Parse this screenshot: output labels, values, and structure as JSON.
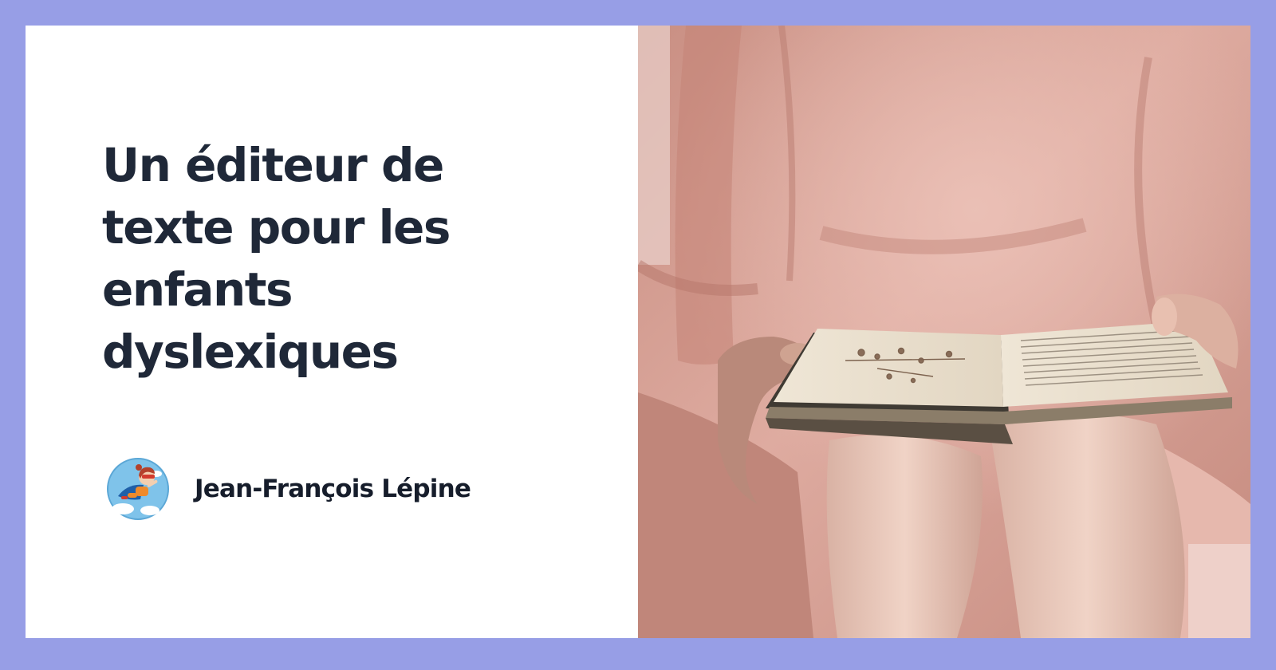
{
  "card": {
    "title": "Un éditeur de texte pour les enfants dyslexiques",
    "author": {
      "name": "Jean-François Lépine",
      "avatar_icon": "superhero-girl-avatar-icon"
    },
    "photo": {
      "subject": "child-reading-book-photo"
    }
  },
  "colors": {
    "frame": "#979ee6",
    "panel": "#ffffff",
    "title_text": "#1f2838",
    "author_text": "#161d2b",
    "sweater": "#d29c90"
  }
}
